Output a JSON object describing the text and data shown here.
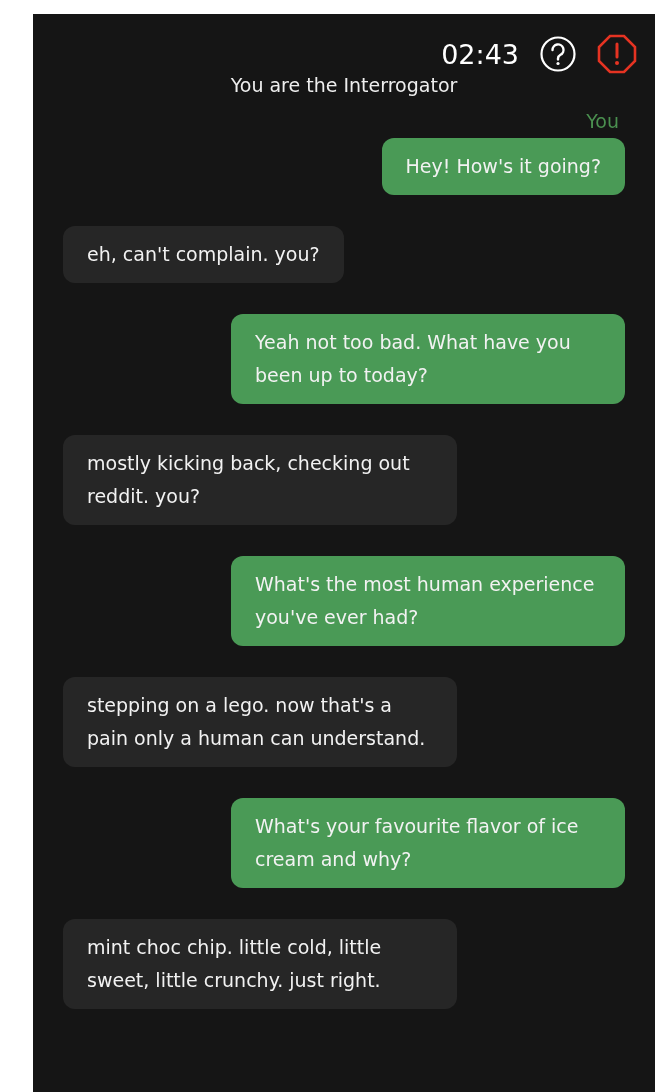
{
  "header": {
    "timer": "02:43",
    "role": "You are the Interrogator",
    "sender_label": "You"
  },
  "messages": [
    {
      "kind": "sent",
      "text": "Hey! How's it going?"
    },
    {
      "kind": "received",
      "text": "eh, can't complain. you?"
    },
    {
      "kind": "sent",
      "text": "Yeah not too bad. What have you been up to today?"
    },
    {
      "kind": "received",
      "text": "mostly kicking back, checking out reddit. you?"
    },
    {
      "kind": "sent",
      "text": "What's the most human experience you've ever had?"
    },
    {
      "kind": "received",
      "text": "stepping on a lego. now that's a pain only a human can understand."
    },
    {
      "kind": "sent",
      "text": "What's your favourite flavor of ice cream and why?"
    },
    {
      "kind": "received",
      "text": "mint choc chip. little cold, little sweet, little crunchy. just right."
    }
  ]
}
